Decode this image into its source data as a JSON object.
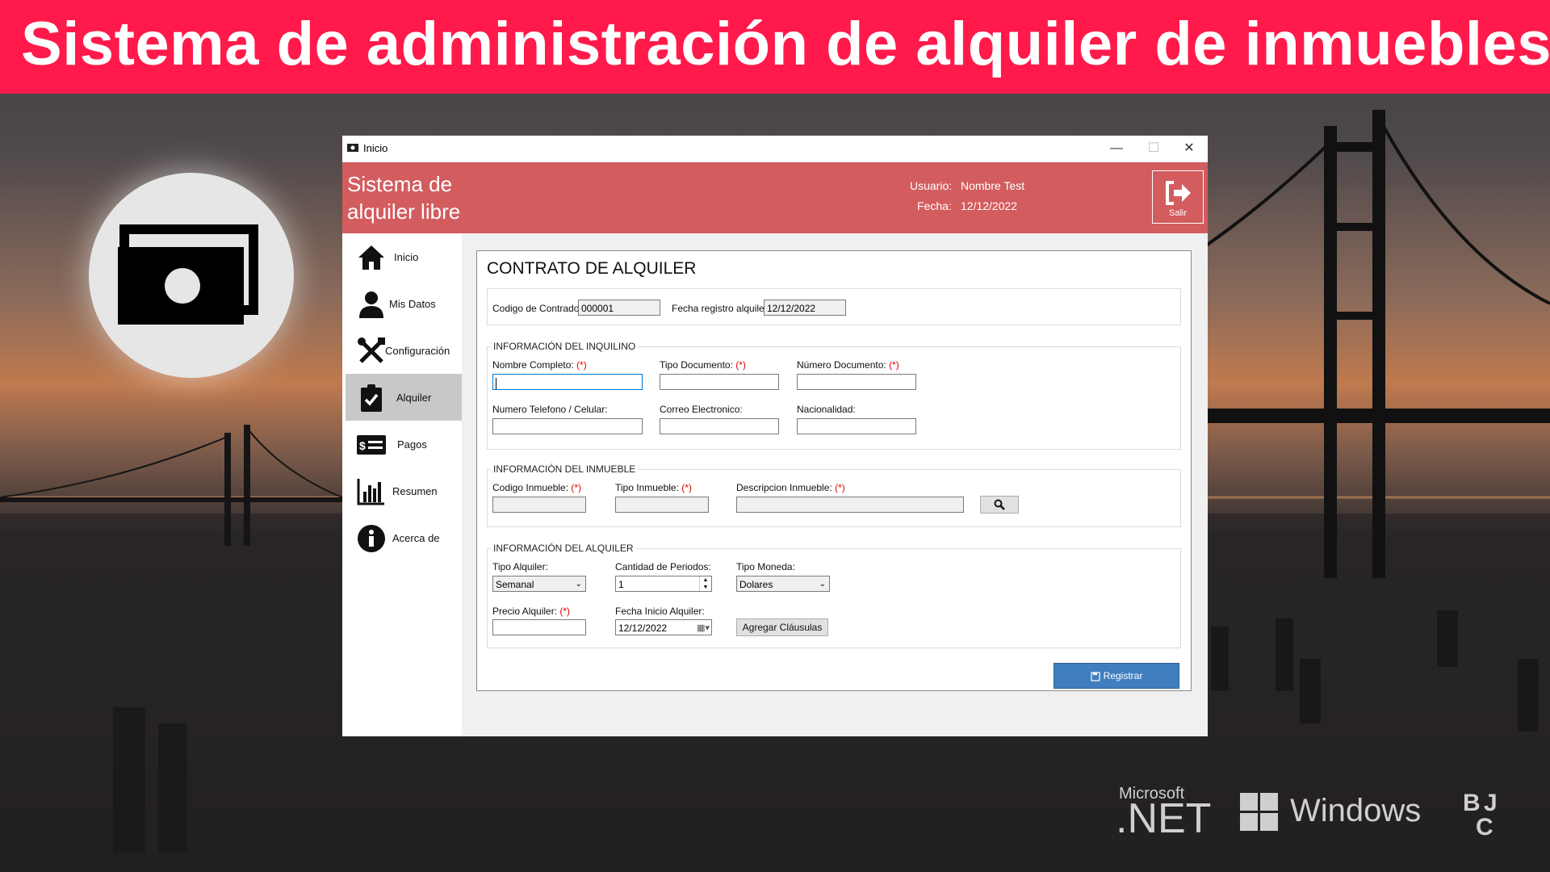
{
  "banner": {
    "title": "Sistema de administración de alquiler de inmuebles"
  },
  "brands": {
    "ms_small": "Microsoft",
    "ms_net": ".NET",
    "windows": "Windows"
  },
  "window": {
    "title": "Inicio",
    "app_title_line1": "Sistema de",
    "app_title_line2": "alquiler libre",
    "usuario_label": "Usuario:",
    "usuario_value": "Nombre Test",
    "fecha_label": "Fecha:",
    "fecha_value": "12/12/2022",
    "salir_label": "Salir",
    "header_color": "#d35c5f"
  },
  "sidebar": {
    "items": [
      {
        "label": "Inicio",
        "icon": "home-icon"
      },
      {
        "label": "Mis Datos",
        "icon": "user-icon"
      },
      {
        "label": "Configuración",
        "icon": "tools-icon"
      },
      {
        "label": "Alquiler",
        "icon": "clipboard-check-icon",
        "active": true
      },
      {
        "label": "Pagos",
        "icon": "money-bill-icon"
      },
      {
        "label": "Resumen",
        "icon": "bar-chart-icon"
      },
      {
        "label": "Acerca de",
        "icon": "info-icon"
      }
    ]
  },
  "form": {
    "title": "CONTRATO DE ALQUILER",
    "codigo_label": "Codigo de Contrado:",
    "codigo_value": "000001",
    "fecha_registro_label": "Fecha registro alquiler:",
    "fecha_registro_value": "12/12/2022",
    "inquilino": {
      "legend": "INFORMACIÓN DEL INQUILINO",
      "nombre_label": "Nombre Completo:",
      "tipo_doc_label": "Tipo Documento:",
      "numero_doc_label": "Número Documento:",
      "telefono_label": "Numero Telefono / Celular:",
      "correo_label": "Correo Electronico:",
      "nacionalidad_label": "Nacionalidad:",
      "required_mark": "(*)"
    },
    "inmueble": {
      "legend": "INFORMACIÓN DEL INMUEBLE",
      "codigo_label": "Codigo Inmueble:",
      "tipo_label": "Tipo Inmueble:",
      "descripcion_label": "Descripcion Inmueble:",
      "required_mark": "(*)"
    },
    "alquiler": {
      "legend": "INFORMACIÓN DEL ALQUILER",
      "tipo_label": "Tipo Alquiler:",
      "tipo_value": "Semanal",
      "cantidad_label": "Cantidad de Periodos:",
      "cantidad_value": "1",
      "moneda_label": "Tipo Moneda:",
      "moneda_value": "Dolares",
      "precio_label": "Precio Alquiler:",
      "fecha_inicio_label": "Fecha Inicio Alquiler:",
      "fecha_inicio_value": "12/12/2022",
      "clausulas_button": "Agregar Cláusulas",
      "required_mark": "(*)"
    },
    "registrar_button": "Registrar",
    "primary_color": "#3f7fbf"
  }
}
